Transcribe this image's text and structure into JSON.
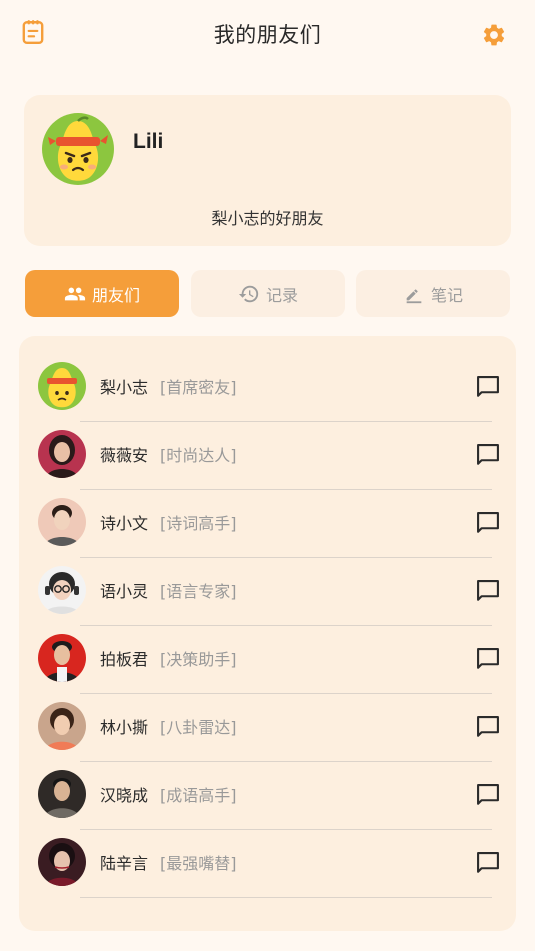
{
  "header": {
    "title": "我的朋友们",
    "left_icon": "notes-icon",
    "right_icon": "gear-icon"
  },
  "profile": {
    "name": "Lili",
    "subtitle": "梨小志的好朋友",
    "avatar": "pear-mascot-avatar"
  },
  "tabs": [
    {
      "label": "朋友们",
      "icon": "people-icon",
      "active": true
    },
    {
      "label": "记录",
      "icon": "history-icon",
      "active": false
    },
    {
      "label": "笔记",
      "icon": "pen-icon",
      "active": false
    }
  ],
  "friends": [
    {
      "name": "梨小志",
      "tag": "[首席密友]"
    },
    {
      "name": "薇薇安",
      "tag": "[时尚达人]"
    },
    {
      "name": "诗小文",
      "tag": "[诗词高手]"
    },
    {
      "name": "语小灵",
      "tag": "[语言专家]"
    },
    {
      "name": "拍板君",
      "tag": "[决策助手]"
    },
    {
      "name": "林小撕",
      "tag": "[八卦雷达]"
    },
    {
      "name": "汉晓成",
      "tag": "[成语高手]"
    },
    {
      "name": "陆辛言",
      "tag": "[最强嘴替]"
    }
  ],
  "colors": {
    "accent": "#f59e3a",
    "background": "#fff8f1",
    "card": "#fdefdf"
  }
}
